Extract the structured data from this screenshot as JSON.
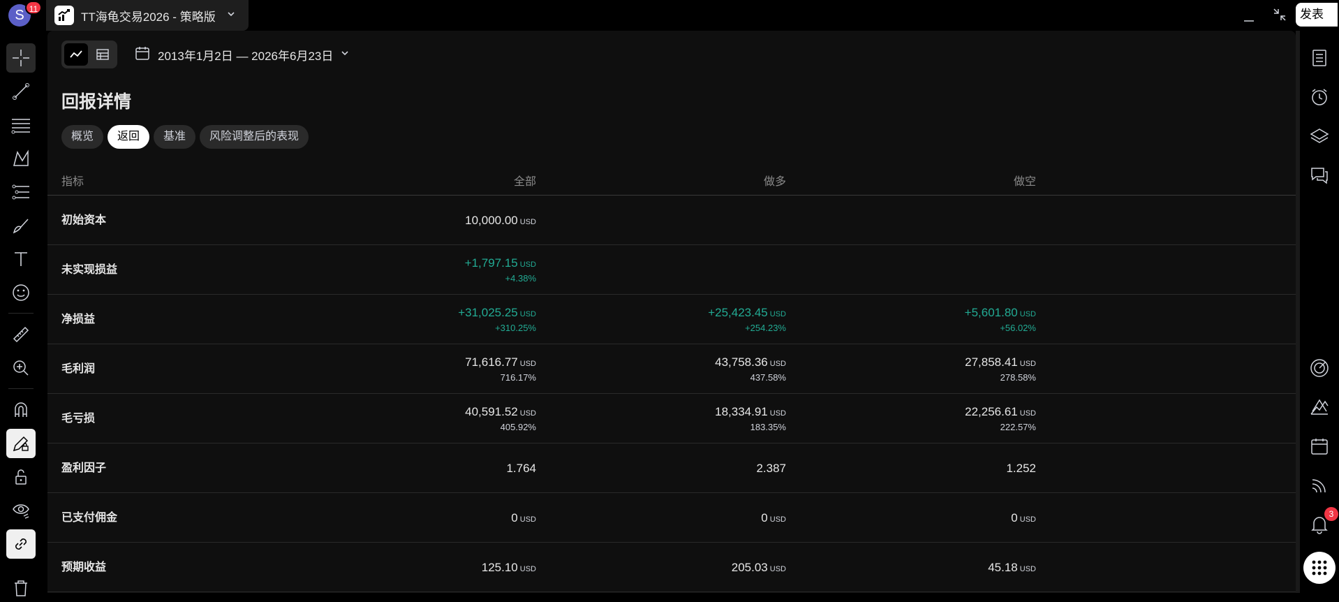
{
  "topbar": {
    "avatar_letter": "S",
    "avatar_badge": "11",
    "tab_title": "TT海龟交易2026 - 策略版",
    "publish_label": "发表"
  },
  "toolbar": {
    "date_range": "2013年1月2日 — 2026年6月23日"
  },
  "section": {
    "title": "回报详情",
    "tabs": [
      {
        "label": "概览",
        "active": false
      },
      {
        "label": "返回",
        "active": true
      },
      {
        "label": "基准",
        "active": false
      },
      {
        "label": "风险调整后的表现",
        "active": false
      }
    ]
  },
  "table": {
    "headers": {
      "metric": "指标",
      "all": "全部",
      "long": "做多",
      "short": "做空"
    },
    "currency": "USD",
    "rows": [
      {
        "label": "初始资本",
        "all": {
          "value": "10,000.00",
          "cur": "USD"
        }
      },
      {
        "label": "未实现损益",
        "all": {
          "value": "+1,797.15",
          "cur": "USD",
          "pct": "+4.38%",
          "positive": true
        }
      },
      {
        "label": "净损益",
        "all": {
          "value": "+31,025.25",
          "cur": "USD",
          "pct": "+310.25%",
          "positive": true
        },
        "long": {
          "value": "+25,423.45",
          "cur": "USD",
          "pct": "+254.23%",
          "positive": true
        },
        "short": {
          "value": "+5,601.80",
          "cur": "USD",
          "pct": "+56.02%",
          "positive": true
        }
      },
      {
        "label": "毛利润",
        "all": {
          "value": "71,616.77",
          "cur": "USD",
          "pct": "716.17%"
        },
        "long": {
          "value": "43,758.36",
          "cur": "USD",
          "pct": "437.58%"
        },
        "short": {
          "value": "27,858.41",
          "cur": "USD",
          "pct": "278.58%"
        }
      },
      {
        "label": "毛亏损",
        "all": {
          "value": "40,591.52",
          "cur": "USD",
          "pct": "405.92%"
        },
        "long": {
          "value": "18,334.91",
          "cur": "USD",
          "pct": "183.35%"
        },
        "short": {
          "value": "22,256.61",
          "cur": "USD",
          "pct": "222.57%"
        }
      },
      {
        "label": "盈利因子",
        "all": {
          "value": "1.764"
        },
        "long": {
          "value": "2.387"
        },
        "short": {
          "value": "1.252"
        }
      },
      {
        "label": "已支付佣金",
        "all": {
          "value": "0",
          "cur": "USD"
        },
        "long": {
          "value": "0",
          "cur": "USD"
        },
        "short": {
          "value": "0",
          "cur": "USD"
        }
      },
      {
        "label": "预期收益",
        "all": {
          "value": "125.10",
          "cur": "USD"
        },
        "long": {
          "value": "205.03",
          "cur": "USD"
        },
        "short": {
          "value": "45.18",
          "cur": "USD"
        }
      }
    ]
  },
  "right_toolbar": {
    "notification_badge": "3",
    "icons": [
      "watchlist-icon",
      "alarm-icon",
      "layers-icon",
      "chat-icon",
      "target-icon",
      "chart-up-icon",
      "calendar-icon",
      "rss-icon",
      "bell-icon",
      "apps-grid-icon"
    ]
  },
  "colors": {
    "positive": "#22ab94",
    "badge": "#f23645",
    "background": "#0f0f0f"
  }
}
